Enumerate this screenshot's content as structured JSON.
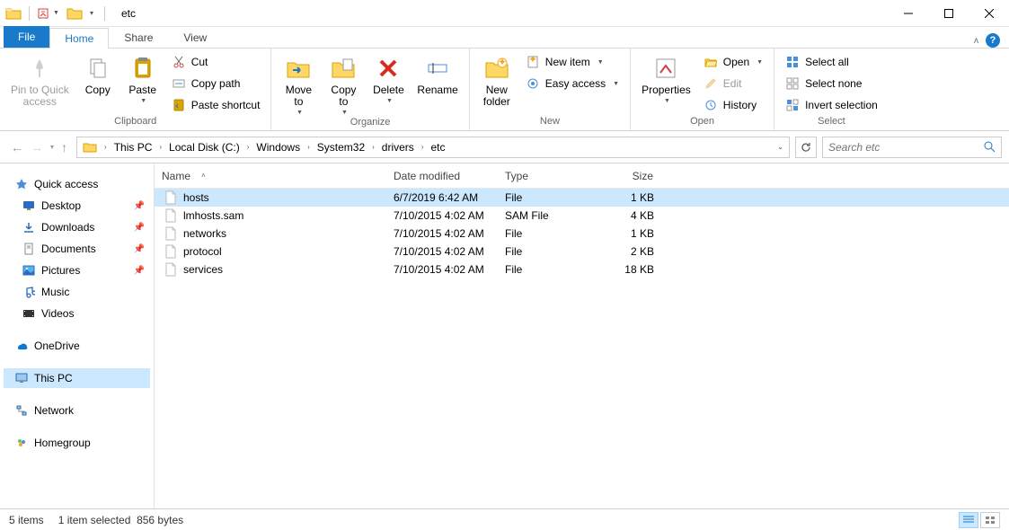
{
  "window": {
    "title": "etc"
  },
  "tabs": {
    "file": "File",
    "home": "Home",
    "share": "Share",
    "view": "View"
  },
  "ribbon": {
    "clipboard": {
      "label": "Clipboard",
      "pin": "Pin to Quick\naccess",
      "copy": "Copy",
      "paste": "Paste",
      "cut": "Cut",
      "copy_path": "Copy path",
      "paste_shortcut": "Paste shortcut"
    },
    "organize": {
      "label": "Organize",
      "move_to": "Move\nto",
      "copy_to": "Copy\nto",
      "delete": "Delete",
      "rename": "Rename"
    },
    "new": {
      "label": "New",
      "new_folder": "New\nfolder",
      "new_item": "New item",
      "easy_access": "Easy access"
    },
    "open": {
      "label": "Open",
      "properties": "Properties",
      "open": "Open",
      "edit": "Edit",
      "history": "History"
    },
    "select": {
      "label": "Select",
      "select_all": "Select all",
      "select_none": "Select none",
      "invert": "Invert selection"
    }
  },
  "breadcrumb": {
    "segments": [
      "This PC",
      "Local Disk (C:)",
      "Windows",
      "System32",
      "drivers",
      "etc"
    ]
  },
  "search": {
    "placeholder": "Search etc"
  },
  "sidebar": {
    "quick_access": "Quick access",
    "desktop": "Desktop",
    "downloads": "Downloads",
    "documents": "Documents",
    "pictures": "Pictures",
    "music": "Music",
    "videos": "Videos",
    "onedrive": "OneDrive",
    "this_pc": "This PC",
    "network": "Network",
    "homegroup": "Homegroup"
  },
  "columns": {
    "name": "Name",
    "date": "Date modified",
    "type": "Type",
    "size": "Size"
  },
  "files": [
    {
      "name": "hosts",
      "date": "6/7/2019 6:42 AM",
      "type": "File",
      "size": "1 KB",
      "selected": true
    },
    {
      "name": "lmhosts.sam",
      "date": "7/10/2015 4:02 AM",
      "type": "SAM File",
      "size": "4 KB",
      "selected": false
    },
    {
      "name": "networks",
      "date": "7/10/2015 4:02 AM",
      "type": "File",
      "size": "1 KB",
      "selected": false
    },
    {
      "name": "protocol",
      "date": "7/10/2015 4:02 AM",
      "type": "File",
      "size": "2 KB",
      "selected": false
    },
    {
      "name": "services",
      "date": "7/10/2015 4:02 AM",
      "type": "File",
      "size": "18 KB",
      "selected": false
    }
  ],
  "status": {
    "items": "5 items",
    "selected": "1 item selected",
    "bytes": "856 bytes"
  }
}
